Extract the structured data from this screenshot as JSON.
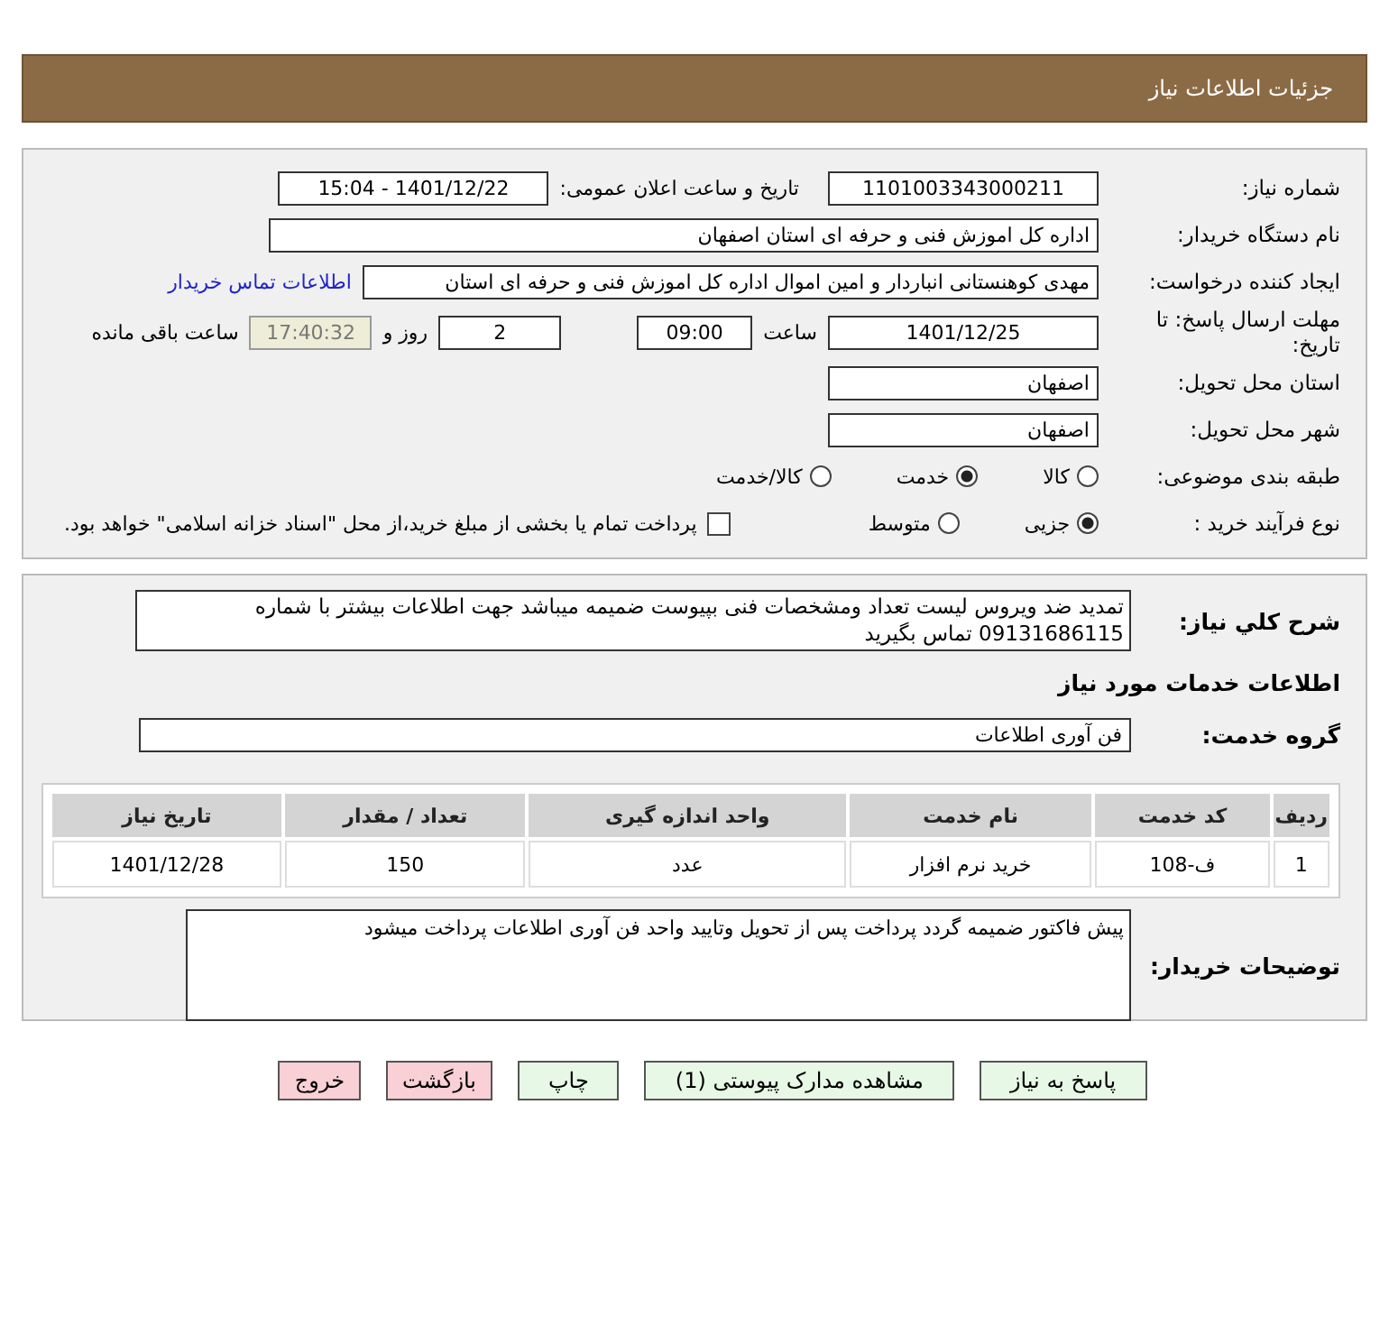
{
  "header": {
    "title": "جزئیات اطلاعات نیاز"
  },
  "details": {
    "need_number": {
      "label": "شماره نیاز:",
      "value": "1101003343000211"
    },
    "announce": {
      "label": "تاریخ و ساعت اعلان عمومی:",
      "value": "1401/12/22 - 15:04"
    },
    "buyer": {
      "label": "نام دستگاه خریدار:",
      "value": "اداره کل اموزش فنی و حرفه ای استان اصفهان"
    },
    "creator": {
      "label": "ایجاد کننده درخواست:",
      "value": "مهدی کوهنستانی انباردار و امین اموال اداره کل اموزش فنی و حرفه ای استان",
      "link": "اطلاعات تماس خریدار"
    },
    "deadline": {
      "label": "مهلت ارسال پاسخ: تا تاریخ:",
      "date": "1401/12/25",
      "time_label": "ساعت",
      "time": "09:00",
      "days": "2",
      "days_label": "روز و",
      "remaining": "17:40:32",
      "remaining_label": "ساعت باقی مانده"
    },
    "province": {
      "label": "استان محل تحویل:",
      "value": "اصفهان"
    },
    "city": {
      "label": "شهر محل تحویل:",
      "value": "اصفهان"
    },
    "category": {
      "label": "طبقه بندی موضوعی:",
      "options": [
        {
          "label": "کالا",
          "selected": false
        },
        {
          "label": "خدمت",
          "selected": true
        },
        {
          "label": "کالا/خدمت",
          "selected": false
        }
      ]
    },
    "process": {
      "label": "نوع فرآیند خرید :",
      "options": [
        {
          "label": "جزیی",
          "selected": true
        },
        {
          "label": "متوسط",
          "selected": false
        }
      ],
      "payment": {
        "checked": false,
        "label": "پرداخت تمام یا بخشی از مبلغ خرید،از محل \"اسناد خزانه اسلامی\" خواهد بود."
      }
    }
  },
  "summary": {
    "label": "شرح کلي نياز:",
    "value": "تمدید ضد ویروس لیست تعداد ومشخصات فنی بپیوست ضمیمه میباشد جهت اطلاعات بیشتر با شماره 09131686115 تماس بگیرید"
  },
  "services_heading": "اطلاعات خدمات مورد نیاز",
  "service_group": {
    "label": "گروه خدمت:",
    "value": "فن آوری اطلاعات"
  },
  "table": {
    "columns": [
      "ردیف",
      "کد خدمت",
      "نام خدمت",
      "واحد اندازه گیری",
      "تعداد / مقدار",
      "تاریخ نیاز"
    ],
    "rows": [
      [
        "1",
        "ف-108",
        "خرید نرم افزار",
        "عدد",
        "150",
        "1401/12/28"
      ]
    ]
  },
  "buyer_notes": {
    "label": "توضیحات خریدار:",
    "value": "پیش فاکتور ضمیمه گردد پرداخت پس از تحویل وتایید واحد فن آوری اطلاعات پرداخت میشود"
  },
  "buttons": [
    {
      "label": "پاسخ به نیاز",
      "kind": "normal"
    },
    {
      "label": "مشاهده مدارک پیوستی (1)",
      "kind": "normal"
    },
    {
      "label": "چاپ",
      "kind": "normal"
    },
    {
      "label": "بازگشت",
      "kind": "danger"
    },
    {
      "label": "خروج",
      "kind": "danger"
    }
  ]
}
